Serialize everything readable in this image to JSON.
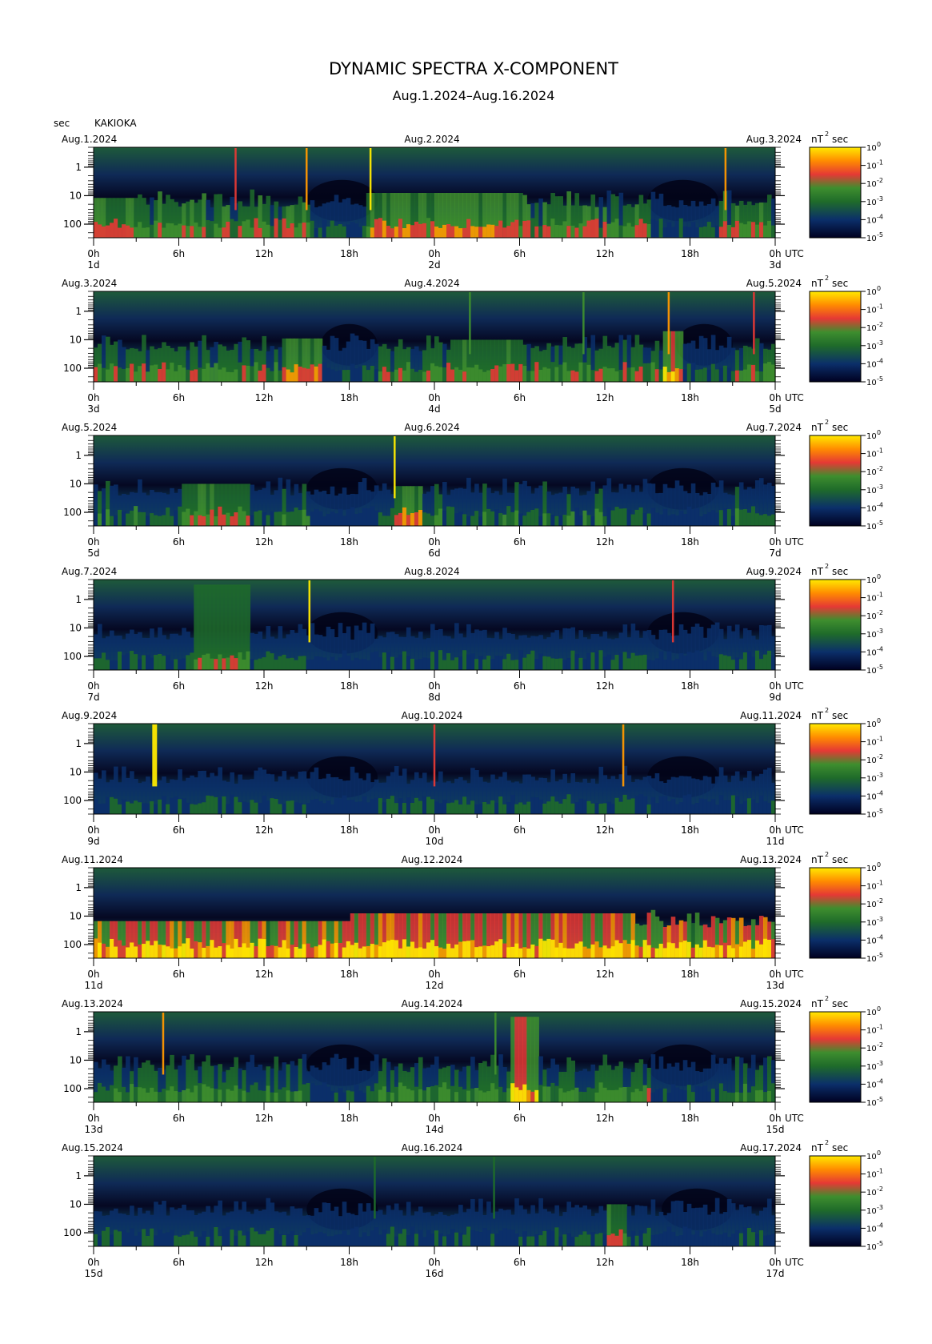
{
  "title": "DYNAMIC SPECTRA X-COMPONENT",
  "subtitle": "Aug.1.2024–Aug.16.2024",
  "station": "KAKIOKA",
  "period_unit": "sec",
  "power_unit": "nT",
  "power_unit_exp": "2",
  "power_unit_suffix": "sec",
  "time_zone": "UTC",
  "colors": {
    "low": "#000030",
    "blue": "#0b2f6a",
    "green": "#2e7d32",
    "bright_green": "#4caf50",
    "red": "#e53935",
    "orange": "#ff8c00",
    "yellow": "#ffea00"
  },
  "chart_data": {
    "type": "heatmap",
    "x_ticks": [
      "0h",
      "6h",
      "12h",
      "18h",
      "0h",
      "6h",
      "12h",
      "18h",
      "0h"
    ],
    "y_ticks": [
      "1",
      "10",
      "100"
    ],
    "color_scale": {
      "base": "10",
      "exponents": [
        "0",
        "-1",
        "-2",
        "-3",
        "-4",
        "-5"
      ],
      "range": [
        -5,
        0
      ],
      "log": true
    },
    "panels": [
      {
        "start_label": "Aug.1.2024",
        "mid_label": "Aug.2.2024",
        "end_label": "Aug.3.2024",
        "day_labels": [
          "1d",
          "2d",
          "3d"
        ],
        "intensity": 0.55,
        "spikes": [
          {
            "hour": 10.0,
            "level": 0.75
          },
          {
            "hour": 15.0,
            "level": 0.85
          },
          {
            "hour": 19.5,
            "level": 1.0
          },
          {
            "hour": 44.5,
            "level": 0.8
          }
        ],
        "quiet": [
          {
            "start": 15,
            "end": 20
          },
          {
            "start": 39,
            "end": 44
          }
        ],
        "bursts": [
          {
            "start": 19,
            "end": 30,
            "level": 0.7,
            "top": 8
          },
          {
            "start": 0,
            "end": 3,
            "level": 0.6,
            "top": 12
          }
        ]
      },
      {
        "start_label": "Aug.3.2024",
        "mid_label": "Aug.4.2024",
        "end_label": "Aug.5.2024",
        "day_labels": [
          "3d",
          "4d",
          "5d"
        ],
        "intensity": 0.5,
        "spikes": [
          {
            "hour": 26.5,
            "level": 0.6
          },
          {
            "hour": 34.5,
            "level": 0.55
          },
          {
            "hour": 40.5,
            "level": 0.85
          },
          {
            "hour": 46.5,
            "level": 0.75
          }
        ],
        "quiet": [
          {
            "start": 16,
            "end": 20
          },
          {
            "start": 41,
            "end": 45
          }
        ],
        "bursts": [
          {
            "start": 13,
            "end": 16,
            "level": 0.7,
            "top": 9
          },
          {
            "start": 25,
            "end": 30,
            "level": 0.6,
            "top": 10
          },
          {
            "start": 40,
            "end": 41.5,
            "level": 0.85,
            "top": 5
          }
        ]
      },
      {
        "start_label": "Aug.5.2024",
        "mid_label": "Aug.6.2024",
        "end_label": "Aug.7.2024",
        "day_labels": [
          "5d",
          "6d",
          "7d"
        ],
        "intensity": 0.35,
        "spikes": [
          {
            "hour": 21.2,
            "level": 1.0
          }
        ],
        "quiet": [
          {
            "start": 15,
            "end": 20
          },
          {
            "start": 39,
            "end": 44
          }
        ],
        "bursts": [
          {
            "start": 6,
            "end": 11,
            "level": 0.6,
            "top": 10
          },
          {
            "start": 21,
            "end": 23,
            "level": 0.7,
            "top": 12
          }
        ]
      },
      {
        "start_label": "Aug.7.2024",
        "mid_label": "Aug.8.2024",
        "end_label": "Aug.9.2024",
        "day_labels": [
          "7d",
          "8d",
          "9d"
        ],
        "intensity": 0.3,
        "spikes": [
          {
            "hour": 15.2,
            "level": 1.0
          },
          {
            "hour": 40.8,
            "level": 0.7
          }
        ],
        "quiet": [
          {
            "start": 15,
            "end": 20
          },
          {
            "start": 39,
            "end": 44
          }
        ],
        "bursts": [
          {
            "start": 7,
            "end": 11,
            "level": 0.55,
            "top": 0.3
          }
        ]
      },
      {
        "start_label": "Aug.9.2024",
        "mid_label": "Aug.10.2024",
        "end_label": "Aug.11.2024",
        "day_labels": [
          "9d",
          "10d",
          "11d"
        ],
        "intensity": 0.3,
        "spikes": [
          {
            "hour": 4.3,
            "level": 1.0,
            "wide": true
          },
          {
            "hour": 24.0,
            "level": 0.75
          },
          {
            "hour": 37.3,
            "level": 0.8
          }
        ],
        "quiet": [
          {
            "start": 15,
            "end": 20
          },
          {
            "start": 39,
            "end": 44
          }
        ],
        "bursts": []
      },
      {
        "start_label": "Aug.11.2024",
        "mid_label": "Aug.12.2024",
        "end_label": "Aug.13.2024",
        "day_labels": [
          "11d",
          "12d",
          "13d"
        ],
        "intensity": 0.95,
        "spikes": [],
        "quiet": [],
        "bursts": [
          {
            "start": 18,
            "end": 38,
            "level": 0.85,
            "top": 8
          },
          {
            "start": 0,
            "end": 18,
            "level": 0.6,
            "top": 15
          }
        ]
      },
      {
        "start_label": "Aug.13.2024",
        "mid_label": "Aug.14.2024",
        "end_label": "Aug.15.2024",
        "day_labels": [
          "13d",
          "14d",
          "15d"
        ],
        "intensity": 0.45,
        "spikes": [
          {
            "hour": 4.9,
            "level": 0.9
          },
          {
            "hour": 28.3,
            "level": 0.6
          }
        ],
        "quiet": [
          {
            "start": 15,
            "end": 20
          },
          {
            "start": 39,
            "end": 44
          }
        ],
        "bursts": [
          {
            "start": 29.3,
            "end": 31.3,
            "level": 0.8,
            "top": 0.3
          }
        ]
      },
      {
        "start_label": "Aug.15.2024",
        "mid_label": "Aug.16.2024",
        "end_label": "Aug.17.2024",
        "day_labels": [
          "15d",
          "16d",
          "17d"
        ],
        "intensity": 0.3,
        "spikes": [
          {
            "hour": 19.8,
            "level": 0.45
          },
          {
            "hour": 28.2,
            "level": 0.4
          }
        ],
        "quiet": [
          {
            "start": 15,
            "end": 20
          },
          {
            "start": 40,
            "end": 45
          }
        ],
        "bursts": [
          {
            "start": 36,
            "end": 37.5,
            "level": 0.55,
            "top": 10
          }
        ]
      }
    ]
  }
}
